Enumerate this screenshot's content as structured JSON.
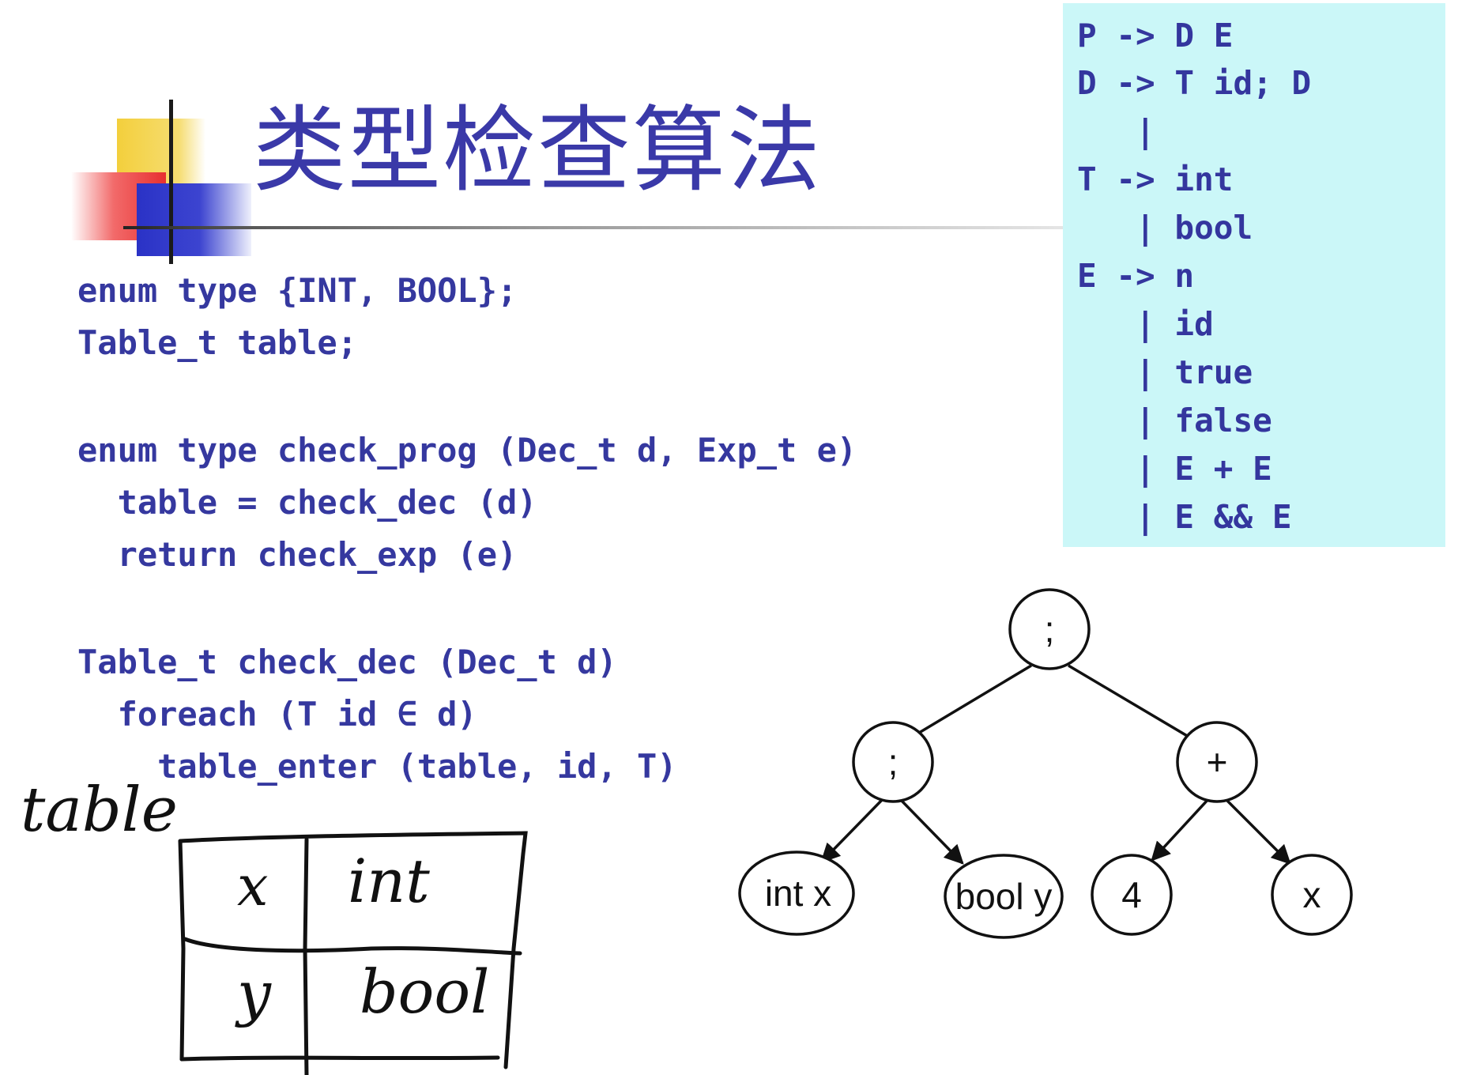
{
  "title": "类型检查算法",
  "grammar": [
    "P -> D E",
    "D -> T id; D",
    "   |",
    "T -> int",
    "   | bool",
    "E -> n",
    "   | id",
    "   | true",
    "   | false",
    "   | E + E",
    "   | E && E"
  ],
  "code": [
    "enum type {INT, BOOL};",
    "Table_t table;",
    "enum type check_prog (Dec_t d, Exp_t e)",
    "  table = check_dec (d)",
    "  return check_exp (e)",
    "Table_t check_dec (Dec_t d)",
    "  foreach (T id ∈ d)",
    "    table_enter (table, id, T)"
  ],
  "handwritten": {
    "caption": "table",
    "rows": [
      [
        "x",
        "int"
      ],
      [
        "y",
        "bool"
      ]
    ]
  },
  "tree": {
    "root": ";",
    "left": ";",
    "right": "+",
    "leaves": [
      "int x",
      "bool y",
      "4",
      "x"
    ]
  }
}
